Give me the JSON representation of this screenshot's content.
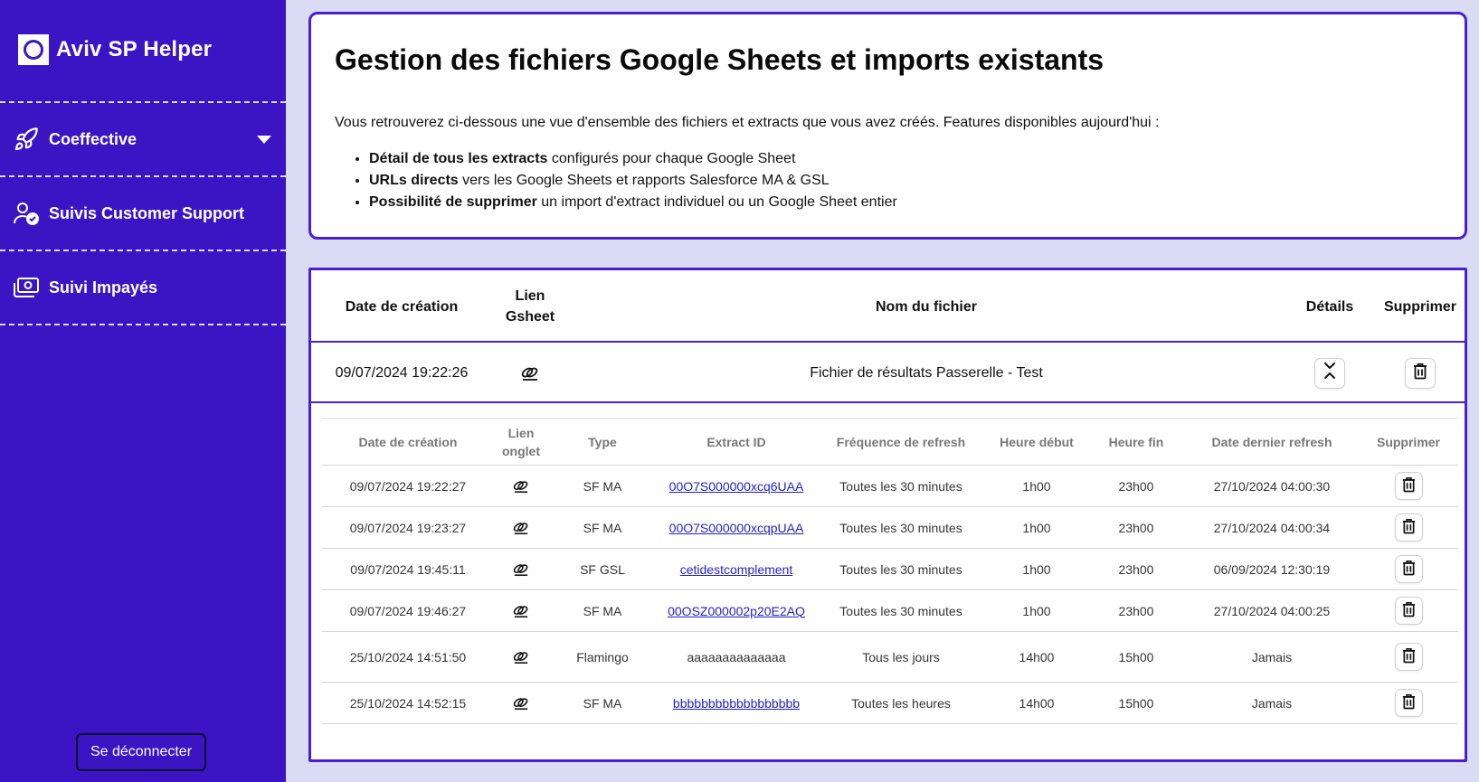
{
  "sidebar": {
    "brand": "Aviv SP Helper",
    "items": [
      {
        "label": "Coeffective",
        "icon": "rocket-icon",
        "has_dropdown": true
      },
      {
        "label": "Suivis Customer Support",
        "icon": "user-check-icon"
      },
      {
        "label": "Suivi Impayés",
        "icon": "money-icon"
      }
    ],
    "logout_label": "Se déconnecter"
  },
  "intro": {
    "title": "Gestion des fichiers Google Sheets et imports existants",
    "lead": "Vous retrouverez ci-dessous une vue d'ensemble des fichiers et extracts que vous avez créés. Features disponibles aujourd'hui :",
    "features": [
      {
        "bold": "Détail de tous les extracts",
        "rest": " configurés pour chaque Google Sheet"
      },
      {
        "bold": "URLs directs",
        "rest": " vers les Google Sheets et rapports Salesforce MA & GSL"
      },
      {
        "bold": "Possibilité de supprimer",
        "rest": " un import d'extract individuel ou un Google Sheet entier"
      }
    ]
  },
  "main_table": {
    "headers": {
      "date": "Date de création",
      "lien_1": "Lien",
      "lien_2": "Gsheet",
      "nom": "Nom du fichier",
      "details": "Détails",
      "supprimer": "Supprimer"
    },
    "row": {
      "date": "09/07/2024 19:22:26",
      "nom": "Fichier de résultats Passerelle - Test"
    }
  },
  "sub_table": {
    "headers": {
      "date": "Date de création",
      "lien_1": "Lien",
      "lien_2": "onglet",
      "type": "Type",
      "extract": "Extract ID",
      "freq": "Fréquence de refresh",
      "debut": "Heure début",
      "fin": "Heure fin",
      "dernier": "Date dernier refresh",
      "supprimer": "Supprimer"
    },
    "rows": [
      {
        "date": "09/07/2024 19:22:27",
        "type": "SF MA",
        "extract": "00O7S000000xcq6UAA",
        "is_link": true,
        "freq": "Toutes les 30 minutes",
        "debut": "1h00",
        "fin": "23h00",
        "dernier": "27/10/2024 04:00:30"
      },
      {
        "date": "09/07/2024 19:23:27",
        "type": "SF MA",
        "extract": "00O7S000000xcqpUAA",
        "is_link": true,
        "freq": "Toutes les 30 minutes",
        "debut": "1h00",
        "fin": "23h00",
        "dernier": "27/10/2024 04:00:34"
      },
      {
        "date": "09/07/2024 19:45:11",
        "type": "SF GSL",
        "extract": "cetidestcomplement",
        "is_link": true,
        "freq": "Toutes les 30 minutes",
        "debut": "1h00",
        "fin": "23h00",
        "dernier": "06/09/2024 12:30:19"
      },
      {
        "date": "09/07/2024 19:46:27",
        "type": "SF MA",
        "extract": "00OSZ000002p20E2AQ",
        "is_link": true,
        "freq": "Toutes les 30 minutes",
        "debut": "1h00",
        "fin": "23h00",
        "dernier": "27/10/2024 04:00:25"
      },
      {
        "date": "25/10/2024 14:51:50",
        "type": "Flamingo",
        "extract": "aaaaaaaaaaaaaa",
        "is_link": false,
        "freq": "Tous les jours",
        "debut": "14h00",
        "fin": "15h00",
        "dernier": "Jamais"
      },
      {
        "date": "25/10/2024 14:52:15",
        "type": "SF MA",
        "extract": "bbbbbbbbbbbbbbbbbb",
        "is_link": true,
        "freq": "Toutes les heures",
        "debut": "14h00",
        "fin": "15h00",
        "dernier": "Jamais"
      }
    ]
  },
  "icons": {
    "link": "link-icon",
    "expand": "expand-collapse-icon",
    "delete": "trash-icon"
  },
  "colors": {
    "sidebar_bg": "#3b14c4",
    "accent_border": "#4a1fd0",
    "page_bg": "#d9dcf4",
    "link": "#1f1fc8"
  }
}
